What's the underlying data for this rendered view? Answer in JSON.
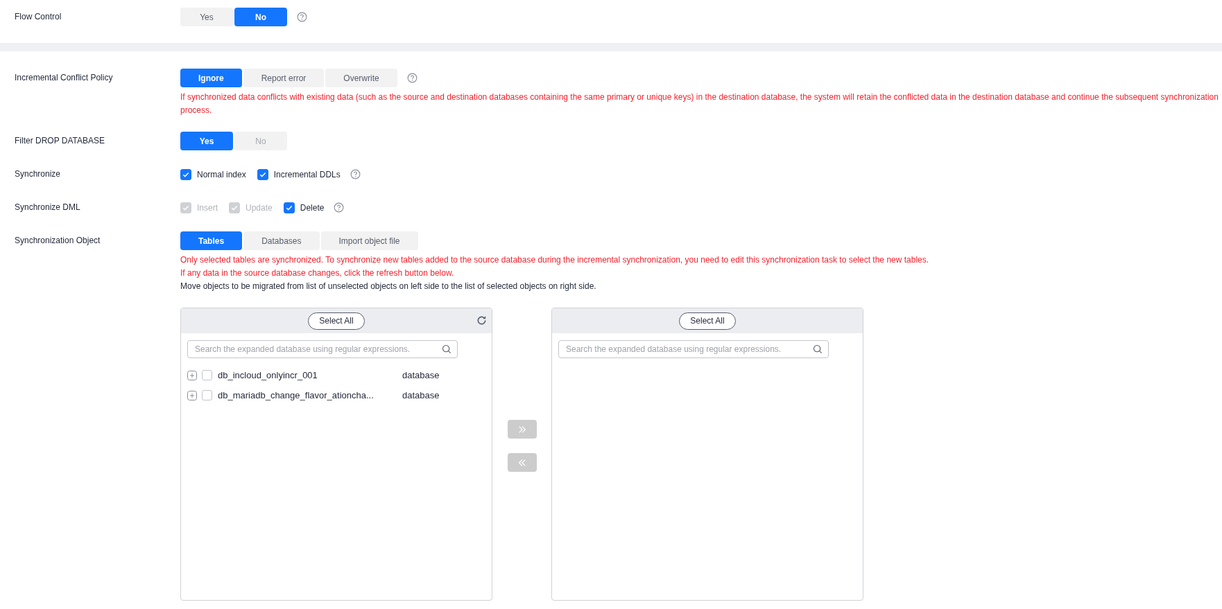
{
  "sections": [
    {
      "rows": [
        {
          "label": "Flow Control",
          "kind": "segmented",
          "help": true,
          "options": [
            {
              "label": "Yes",
              "selected": false,
              "disabled": false
            },
            {
              "label": "No",
              "selected": true,
              "disabled": false
            }
          ],
          "notes": []
        }
      ]
    },
    {
      "rows": [
        {
          "label": "Incremental Conflict Policy",
          "kind": "segmented",
          "help": true,
          "options": [
            {
              "label": "Ignore",
              "selected": true,
              "disabled": false
            },
            {
              "label": "Report error",
              "selected": false,
              "disabled": false
            },
            {
              "label": "Overwrite",
              "selected": false,
              "disabled": false
            }
          ],
          "notes": [
            {
              "kind": "warning",
              "text": "If synchronized data conflicts with existing data (such as the source and destination databases containing the same primary or unique keys) in the destination database, the system will retain the conflicted data in the destination database and continue the subsequent synchronization process."
            }
          ]
        },
        {
          "label": "Filter DROP DATABASE",
          "kind": "segmented",
          "help": false,
          "options": [
            {
              "label": "Yes",
              "selected": true,
              "disabled": false
            },
            {
              "label": "No",
              "selected": false,
              "disabled": true
            }
          ],
          "notes": []
        },
        {
          "label": "Synchronize",
          "kind": "checkboxes",
          "help": true,
          "options": [
            {
              "label": "Normal index",
              "checked": true,
              "disabled": false
            },
            {
              "label": "Incremental DDLs",
              "checked": true,
              "disabled": false
            }
          ],
          "notes": []
        },
        {
          "label": "Synchronize DML",
          "kind": "checkboxes",
          "help": true,
          "options": [
            {
              "label": "Insert",
              "checked": true,
              "disabled": true
            },
            {
              "label": "Update",
              "checked": true,
              "disabled": true
            },
            {
              "label": "Delete",
              "checked": true,
              "disabled": false
            }
          ],
          "notes": []
        },
        {
          "label": "Synchronization Object",
          "kind": "segmented",
          "help": false,
          "options": [
            {
              "label": "Tables",
              "selected": true,
              "disabled": false
            },
            {
              "label": "Databases",
              "selected": false,
              "disabled": false
            },
            {
              "label": "Import object file",
              "selected": false,
              "disabled": false
            }
          ],
          "notes": [
            {
              "kind": "warning",
              "text": "Only selected tables are synchronized. To synchronize new tables added to the source database during the incremental synchronization, you need to edit this synchronization task to select the new tables."
            },
            {
              "kind": "warning",
              "text": "If any data in the source database changes, click the refresh button below."
            },
            {
              "kind": "info",
              "text": "Move objects to be migrated from list of unselected objects on left side to the list of selected objects on right side."
            }
          ]
        }
      ]
    }
  ],
  "transfer": {
    "left": {
      "select_all": "Select All",
      "refresh": true,
      "search_placeholder": "Search the expanded database using regular expressions.",
      "items": [
        {
          "name": "db_incloud_onlyincr_001",
          "type": "database",
          "checked": false
        },
        {
          "name": "db_mariadb_change_flavor_ationcha...",
          "type": "database",
          "checked": false
        }
      ]
    },
    "move_buttons": [
      {
        "kind": "add",
        "disabled": true
      },
      {
        "kind": "remove",
        "disabled": true
      }
    ],
    "right": {
      "select_all": "Select All",
      "refresh": false,
      "search_placeholder": "Search the expanded database using regular expressions."
    }
  }
}
